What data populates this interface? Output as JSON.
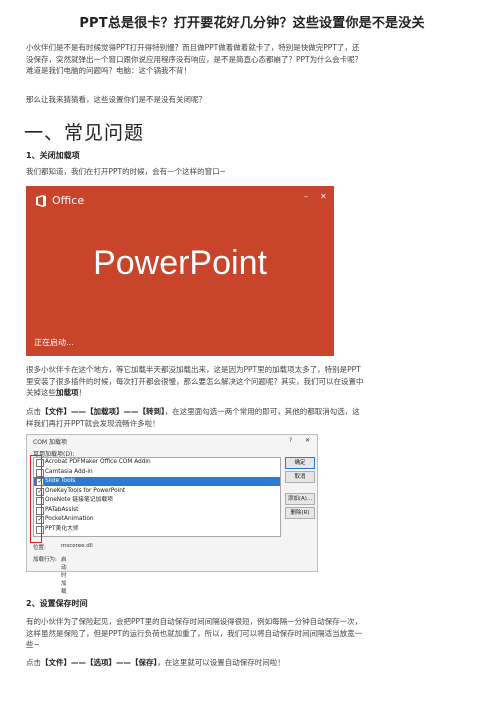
{
  "title": "PPT总是很卡？打开要花好几分钟？这些设置你是不是没关",
  "intro": "小伙伴们是不是有时候觉得PPT打开得特别慢？而且做PPT做着做着就卡了，特别是快做完PPT了，还没保存，突然就弹出一个窗口跟你说应用程序没有响应，是不是简直心态都崩了？PPT为什么会卡呢？难道是我们电脑的问题吗？电脑：这个锅我不背！",
  "intro2": "那么让我来猜猜看，这些设置你们是不是没有关闭呢？",
  "section1": "一、常见问题",
  "h_close_addins": "1、关闭加载项",
  "p_know": "我们都知道，我们在打开PPT的时候，会有一个这样的窗口~",
  "splash": {
    "brand": "Office",
    "product": "PowerPoint",
    "starting": "正在启动...",
    "ctrl_min": "–",
    "ctrl_close": "✕",
    "bg_color": "#c8442a"
  },
  "p_addins": "很多小伙伴卡在这个地方，等它加载半天都没加载出来，这是因为PPT里的加载项太多了，特别是PPT里安装了很多插件的时候，每次打开都会很慢，那么要怎么解决这个问题呢？其实，我们可以在设置中关掉这些",
  "p_addins_bold": "加载项",
  "p_addins_end": "！",
  "p_click1_pre": "点击",
  "p_click1_path": "【文件】——【加载项】——【转到】",
  "p_click1_post": "，在这里面勾选一两个常用的即可，其他的都取消勾选，这样我们再打开PPT就会发现流畅许多啦！",
  "dialog": {
    "title": "COM 加载项",
    "help": "?",
    "close": "✕",
    "list_label": "可用加载项(D):",
    "addins": [
      {
        "name": "Acrobat PDFMaker Office COM Addin",
        "checked": false,
        "selected": false
      },
      {
        "name": "Camtasia Add-in",
        "checked": false,
        "selected": false
      },
      {
        "name": "Slide Tools",
        "checked": true,
        "selected": true
      },
      {
        "name": "OneKeyTools for PowerPoint",
        "checked": true,
        "selected": false
      },
      {
        "name": "OneNote 链接笔记加载项",
        "checked": false,
        "selected": false
      },
      {
        "name": "PATabAssist",
        "checked": false,
        "selected": false
      },
      {
        "name": "PocketAnimation",
        "checked": true,
        "selected": false
      },
      {
        "name": "PPT美化大师",
        "checked": false,
        "selected": false
      }
    ],
    "btn_ok": "确定",
    "btn_cancel": "取消",
    "btn_add": "添加(A)...",
    "btn_remove": "删除(R)",
    "location_label": "位置:",
    "location_value": "mscoree.dll",
    "behavior_label": "加载行为:",
    "behavior_value": "启动时加载"
  },
  "h_autosave": "2、设置保存时间",
  "p_autosave": "有的小伙伴为了保险起见，会把PPT里的自动保存时间间隔设得很短，例如每隔一分钟自动保存一次，这样虽然是保险了，但是PPT的运行负荷也就加重了，所以，我们可以将自动保存时间间隔适当放宽一些~",
  "p_click2_pre": "点击",
  "p_click2_path": "【文件】——【选项】——【保存】",
  "p_click2_post": "，在这里就可以设置自动保存时间啦！"
}
